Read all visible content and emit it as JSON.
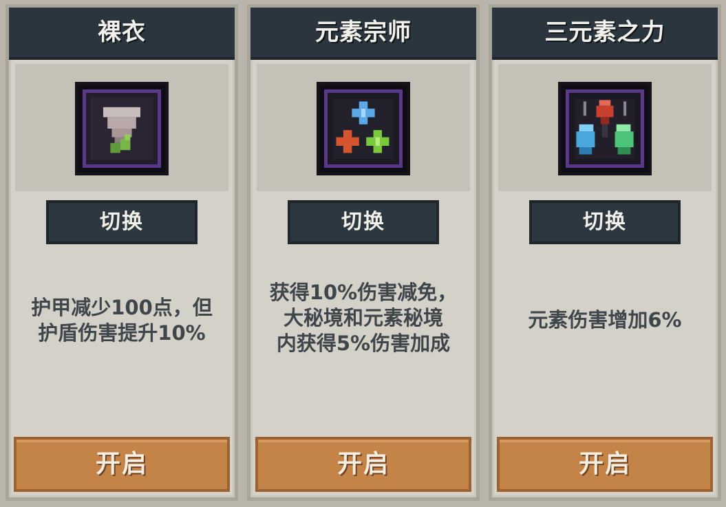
{
  "cards": [
    {
      "title": "裸衣",
      "icon": "bare-clothes-icon",
      "switch_label": "切换",
      "description": [
        "护甲减少100点，但",
        "护盾伤害提升10%"
      ],
      "open_label": "开启"
    },
    {
      "title": "元素宗师",
      "icon": "element-master-icon",
      "switch_label": "切换",
      "description": [
        "获得10%伤害减免，",
        "大秘境和元素秘境",
        "内获得5%伤害加成"
      ],
      "open_label": "开启"
    },
    {
      "title": "三元素之力",
      "icon": "three-elements-icon",
      "switch_label": "切换",
      "description": [
        "元素伤害增加6%"
      ],
      "open_label": "开启"
    }
  ],
  "colors": {
    "title_bar": "#2b353d",
    "panel": "#d4d1c8",
    "open_button": "#c48448",
    "icon_border": "#5a3a88"
  }
}
